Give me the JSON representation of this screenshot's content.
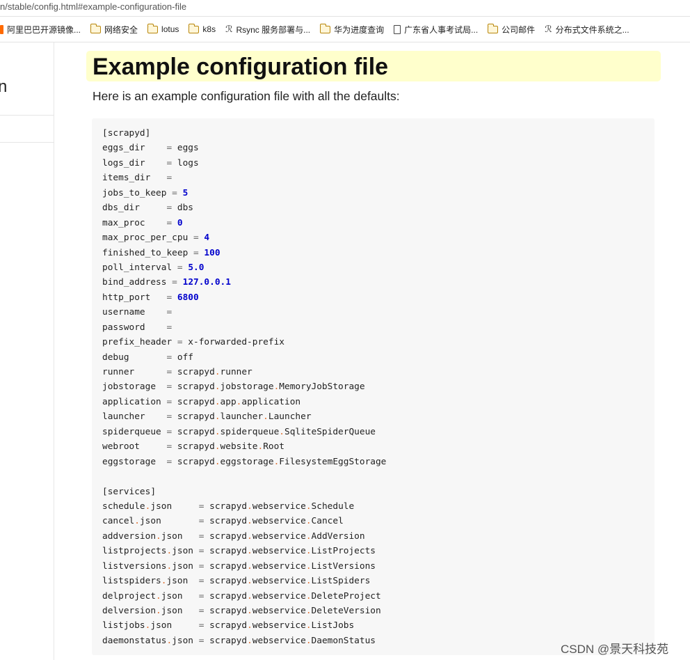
{
  "browser": {
    "url_fragment": "n/stable/config.html#example-configuration-file",
    "bookmarks": [
      {
        "label": "阿里巴巴开源镜像...",
        "icon": "alibaba-icon"
      },
      {
        "label": "网络安全",
        "icon": "folder-icon"
      },
      {
        "label": "lotus",
        "icon": "folder-icon"
      },
      {
        "label": "k8s",
        "icon": "folder-icon"
      },
      {
        "label": "Rsync 服务部署与...",
        "icon": "rsync-icon"
      },
      {
        "label": "华为进度查询",
        "icon": "folder-icon"
      },
      {
        "label": "广东省人事考试局...",
        "icon": "document-icon"
      },
      {
        "label": "公司邮件",
        "icon": "folder-icon"
      },
      {
        "label": "分布式文件系统之...",
        "icon": "rsync-icon"
      }
    ]
  },
  "sidebar": {
    "fragment": "n"
  },
  "content": {
    "heading": "Example configuration file",
    "intro": "Here is an example configuration file with all the defaults:",
    "code_lines": [
      [
        {
          "t": "[scrapyd]"
        }
      ],
      [
        {
          "t": "eggs_dir    "
        },
        {
          "t": "=",
          "c": "op"
        },
        {
          "t": " eggs"
        }
      ],
      [
        {
          "t": "logs_dir    "
        },
        {
          "t": "=",
          "c": "op"
        },
        {
          "t": " logs"
        }
      ],
      [
        {
          "t": "items_dir   "
        },
        {
          "t": "=",
          "c": "op"
        }
      ],
      [
        {
          "t": "jobs_to_keep "
        },
        {
          "t": "=",
          "c": "op"
        },
        {
          "t": " "
        },
        {
          "t": "5",
          "c": "num"
        }
      ],
      [
        {
          "t": "dbs_dir     "
        },
        {
          "t": "=",
          "c": "op"
        },
        {
          "t": " dbs"
        }
      ],
      [
        {
          "t": "max_proc    "
        },
        {
          "t": "=",
          "c": "op"
        },
        {
          "t": " "
        },
        {
          "t": "0",
          "c": "num"
        }
      ],
      [
        {
          "t": "max_proc_per_cpu "
        },
        {
          "t": "=",
          "c": "op"
        },
        {
          "t": " "
        },
        {
          "t": "4",
          "c": "num"
        }
      ],
      [
        {
          "t": "finished_to_keep "
        },
        {
          "t": "=",
          "c": "op"
        },
        {
          "t": " "
        },
        {
          "t": "100",
          "c": "num"
        }
      ],
      [
        {
          "t": "poll_interval "
        },
        {
          "t": "=",
          "c": "op"
        },
        {
          "t": " "
        },
        {
          "t": "5.0",
          "c": "num"
        }
      ],
      [
        {
          "t": "bind_address "
        },
        {
          "t": "=",
          "c": "op"
        },
        {
          "t": " "
        },
        {
          "t": "127.0.0.1",
          "c": "num"
        }
      ],
      [
        {
          "t": "http_port   "
        },
        {
          "t": "=",
          "c": "op"
        },
        {
          "t": " "
        },
        {
          "t": "6800",
          "c": "num"
        }
      ],
      [
        {
          "t": "username    "
        },
        {
          "t": "=",
          "c": "op"
        }
      ],
      [
        {
          "t": "password    "
        },
        {
          "t": "=",
          "c": "op"
        }
      ],
      [
        {
          "t": "prefix_header "
        },
        {
          "t": "=",
          "c": "op"
        },
        {
          "t": " x-forwarded-prefix"
        }
      ],
      [
        {
          "t": "debug       "
        },
        {
          "t": "=",
          "c": "op"
        },
        {
          "t": " off"
        }
      ],
      [
        {
          "t": "runner      "
        },
        {
          "t": "=",
          "c": "op"
        },
        {
          "t": " scrapyd"
        },
        {
          "t": ".",
          "c": "dot"
        },
        {
          "t": "runner"
        }
      ],
      [
        {
          "t": "jobstorage  "
        },
        {
          "t": "=",
          "c": "op"
        },
        {
          "t": " scrapyd"
        },
        {
          "t": ".",
          "c": "dot"
        },
        {
          "t": "jobstorage"
        },
        {
          "t": ".",
          "c": "dot"
        },
        {
          "t": "MemoryJobStorage"
        }
      ],
      [
        {
          "t": "application "
        },
        {
          "t": "=",
          "c": "op"
        },
        {
          "t": " scrapyd"
        },
        {
          "t": ".",
          "c": "dot"
        },
        {
          "t": "app"
        },
        {
          "t": ".",
          "c": "dot"
        },
        {
          "t": "application"
        }
      ],
      [
        {
          "t": "launcher    "
        },
        {
          "t": "=",
          "c": "op"
        },
        {
          "t": " scrapyd"
        },
        {
          "t": ".",
          "c": "dot"
        },
        {
          "t": "launcher"
        },
        {
          "t": ".",
          "c": "dot"
        },
        {
          "t": "Launcher"
        }
      ],
      [
        {
          "t": "spiderqueue "
        },
        {
          "t": "=",
          "c": "op"
        },
        {
          "t": " scrapyd"
        },
        {
          "t": ".",
          "c": "dot"
        },
        {
          "t": "spiderqueue"
        },
        {
          "t": ".",
          "c": "dot"
        },
        {
          "t": "SqliteSpiderQueue"
        }
      ],
      [
        {
          "t": "webroot     "
        },
        {
          "t": "=",
          "c": "op"
        },
        {
          "t": " scrapyd"
        },
        {
          "t": ".",
          "c": "dot"
        },
        {
          "t": "website"
        },
        {
          "t": ".",
          "c": "dot"
        },
        {
          "t": "Root"
        }
      ],
      [
        {
          "t": "eggstorage  "
        },
        {
          "t": "=",
          "c": "op"
        },
        {
          "t": " scrapyd"
        },
        {
          "t": ".",
          "c": "dot"
        },
        {
          "t": "eggstorage"
        },
        {
          "t": ".",
          "c": "dot"
        },
        {
          "t": "FilesystemEggStorage"
        }
      ],
      [
        {
          "t": ""
        }
      ],
      [
        {
          "t": "[services]"
        }
      ],
      [
        {
          "t": "schedule"
        },
        {
          "t": ".",
          "c": "dot"
        },
        {
          "t": "json     "
        },
        {
          "t": "=",
          "c": "op"
        },
        {
          "t": " scrapyd"
        },
        {
          "t": ".",
          "c": "dot"
        },
        {
          "t": "webservice"
        },
        {
          "t": ".",
          "c": "dot"
        },
        {
          "t": "Schedule"
        }
      ],
      [
        {
          "t": "cancel"
        },
        {
          "t": ".",
          "c": "dot"
        },
        {
          "t": "json       "
        },
        {
          "t": "=",
          "c": "op"
        },
        {
          "t": " scrapyd"
        },
        {
          "t": ".",
          "c": "dot"
        },
        {
          "t": "webservice"
        },
        {
          "t": ".",
          "c": "dot"
        },
        {
          "t": "Cancel"
        }
      ],
      [
        {
          "t": "addversion"
        },
        {
          "t": ".",
          "c": "dot"
        },
        {
          "t": "json   "
        },
        {
          "t": "=",
          "c": "op"
        },
        {
          "t": " scrapyd"
        },
        {
          "t": ".",
          "c": "dot"
        },
        {
          "t": "webservice"
        },
        {
          "t": ".",
          "c": "dot"
        },
        {
          "t": "AddVersion"
        }
      ],
      [
        {
          "t": "listprojects"
        },
        {
          "t": ".",
          "c": "dot"
        },
        {
          "t": "json "
        },
        {
          "t": "=",
          "c": "op"
        },
        {
          "t": " scrapyd"
        },
        {
          "t": ".",
          "c": "dot"
        },
        {
          "t": "webservice"
        },
        {
          "t": ".",
          "c": "dot"
        },
        {
          "t": "ListProjects"
        }
      ],
      [
        {
          "t": "listversions"
        },
        {
          "t": ".",
          "c": "dot"
        },
        {
          "t": "json "
        },
        {
          "t": "=",
          "c": "op"
        },
        {
          "t": " scrapyd"
        },
        {
          "t": ".",
          "c": "dot"
        },
        {
          "t": "webservice"
        },
        {
          "t": ".",
          "c": "dot"
        },
        {
          "t": "ListVersions"
        }
      ],
      [
        {
          "t": "listspiders"
        },
        {
          "t": ".",
          "c": "dot"
        },
        {
          "t": "json  "
        },
        {
          "t": "=",
          "c": "op"
        },
        {
          "t": " scrapyd"
        },
        {
          "t": ".",
          "c": "dot"
        },
        {
          "t": "webservice"
        },
        {
          "t": ".",
          "c": "dot"
        },
        {
          "t": "ListSpiders"
        }
      ],
      [
        {
          "t": "delproject"
        },
        {
          "t": ".",
          "c": "dot"
        },
        {
          "t": "json   "
        },
        {
          "t": "=",
          "c": "op"
        },
        {
          "t": " scrapyd"
        },
        {
          "t": ".",
          "c": "dot"
        },
        {
          "t": "webservice"
        },
        {
          "t": ".",
          "c": "dot"
        },
        {
          "t": "DeleteProject"
        }
      ],
      [
        {
          "t": "delversion"
        },
        {
          "t": ".",
          "c": "dot"
        },
        {
          "t": "json   "
        },
        {
          "t": "=",
          "c": "op"
        },
        {
          "t": " scrapyd"
        },
        {
          "t": ".",
          "c": "dot"
        },
        {
          "t": "webservice"
        },
        {
          "t": ".",
          "c": "dot"
        },
        {
          "t": "DeleteVersion"
        }
      ],
      [
        {
          "t": "listjobs"
        },
        {
          "t": ".",
          "c": "dot"
        },
        {
          "t": "json     "
        },
        {
          "t": "=",
          "c": "op"
        },
        {
          "t": " scrapyd"
        },
        {
          "t": ".",
          "c": "dot"
        },
        {
          "t": "webservice"
        },
        {
          "t": ".",
          "c": "dot"
        },
        {
          "t": "ListJobs"
        }
      ],
      [
        {
          "t": "daemonstatus"
        },
        {
          "t": ".",
          "c": "dot"
        },
        {
          "t": "json "
        },
        {
          "t": "=",
          "c": "op"
        },
        {
          "t": " scrapyd"
        },
        {
          "t": ".",
          "c": "dot"
        },
        {
          "t": "webservice"
        },
        {
          "t": ".",
          "c": "dot"
        },
        {
          "t": "DaemonStatus"
        }
      ]
    ]
  },
  "watermark": "CSDN @景天科技苑",
  "colors": {
    "heading_bg": "#ffffcc",
    "code_bg": "#f7f7f7",
    "number": "#0000cc",
    "dot": "#e06a28"
  }
}
